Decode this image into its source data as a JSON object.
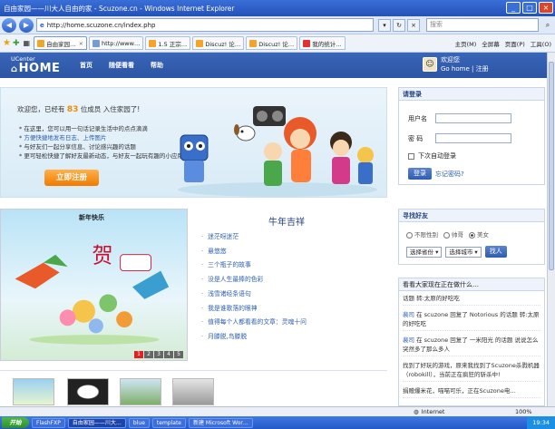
{
  "window": {
    "title": "自由家园——川大人自由的家 - Scuzone.cn - Windows Internet Explorer"
  },
  "address": {
    "url": "http://home.scuzone.cn/index.php",
    "search_placeholder": "搜索"
  },
  "tabs": [
    {
      "label": "自由家园…",
      "active": true
    },
    {
      "label": "http://www…",
      "active": false
    },
    {
      "label": "1.5 正宗…",
      "active": false
    },
    {
      "label": "Discuz! 论…",
      "active": false
    },
    {
      "label": "Discuz! 论…",
      "active": false
    },
    {
      "label": "我的统计…",
      "active": false
    }
  ],
  "ie_tools": {
    "home": "主页(M)",
    "fullscreen": "全屏幕",
    "page": "页面(P)",
    "tools": "工具(O)"
  },
  "site": {
    "logo_top": "UCenter",
    "logo_main": "HOME",
    "nav": [
      "首页",
      "随便看看",
      "帮助"
    ],
    "user_greeting": "欢迎您",
    "user_links": "Go home | 注册"
  },
  "banner": {
    "welcome_prefix": "欢迎您，已经有",
    "member_count": "83",
    "welcome_suffix": "位成员 入住家园了!",
    "features": [
      "在这里，您可以用一句话记录生活中的点点滴滴",
      "方便快捷地发布日志、上传图片",
      "与好友们一起分享信息、讨论感兴趣的话题",
      "更可轻松快捷了解好友最新动态，与好友一起玩有趣的小应用"
    ],
    "register_label": "立即注册"
  },
  "login": {
    "title": "请登录",
    "username_label": "用户名",
    "password_label": "密  码",
    "remember_label": "下次自动登录",
    "submit_label": "登录",
    "forgot_label": "忘记密码?"
  },
  "slideshow": {
    "title": "新年快乐",
    "pages": [
      "1",
      "2",
      "3",
      "4",
      "5"
    ],
    "current_page": "1"
  },
  "articles": {
    "heading": "牛年吉祥",
    "items": [
      "迷茫呀迷茫",
      "悬悠悠",
      "三个瓶子的故事",
      "没是人生最捧的色彩",
      "浅雪诸经条语句",
      "我是谁歌落的眼神",
      "值得每个人都看看的文章：灵魂十问",
      "月滕脱,鸟滕脱"
    ]
  },
  "find_friends": {
    "title": "寻找好友",
    "genders": [
      {
        "label": "不限性别",
        "checked": false
      },
      {
        "label": "帅哥",
        "checked": false
      },
      {
        "label": "美女",
        "checked": true
      }
    ],
    "province_select": "选择省份",
    "city_select": "选择城市",
    "submit_label": "找人"
  },
  "activity": {
    "title": "看看大家现在正在做什么…",
    "items": [
      {
        "user": "",
        "text": "话题 转:太原的好吃吃"
      },
      {
        "user": "裴司",
        "text": "在 scuzone 回复了 Notorious 的话题 转:太原的好吃吃"
      },
      {
        "user": "裴司",
        "text": "在 scuzone 回复了 一米阳光 的话题 说说怎么突然多了那么多人"
      },
      {
        "user": "",
        "text": "找到了好玩的游戏，原来我找到了Scuzone杀戮机器（robokill），当前正在疯狂的斩杀中!"
      },
      {
        "user": "",
        "text": "捐赠爆米花，喵喵可乐，正在Scuzone电…"
      }
    ]
  },
  "status": {
    "zone": "Internet",
    "zoom": "100%"
  },
  "taskbar": {
    "start": "开始",
    "tasks": [
      {
        "label": "FlashFXP",
        "active": false
      },
      {
        "label": "自由家园——川大…",
        "active": true
      },
      {
        "label": "blue",
        "active": false
      },
      {
        "label": "template",
        "active": false
      },
      {
        "label": "新建 Microsoft Wor…",
        "active": false
      }
    ],
    "clock": "19:34"
  }
}
